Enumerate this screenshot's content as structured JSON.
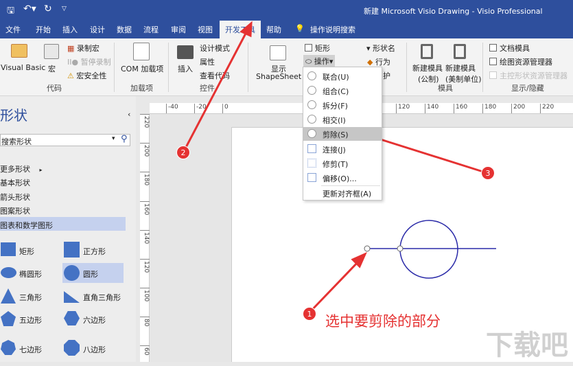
{
  "title": "新建 Microsoft Visio Drawing  -  Visio Professional",
  "tabs": [
    "文件",
    "开始",
    "插入",
    "设计",
    "数据",
    "流程",
    "审阅",
    "视图",
    "开发工具",
    "帮助",
    "操作说明搜索"
  ],
  "ribbon": {
    "code": {
      "vb": "Visual Basic",
      "macro": "宏",
      "record": "录制宏",
      "pause": "暂停录制",
      "security": "宏安全性",
      "group": "代码"
    },
    "addins": {
      "com": "COM 加载项",
      "group": "加载项"
    },
    "controls": {
      "insert": "插入",
      "design": "设计模式",
      "props": "属性",
      "viewcode": "查看代码",
      "group": "控件"
    },
    "shape": {
      "show": "显示",
      "shapesheet": "ShapeSheet",
      "rect": "矩形",
      "ops": "操作",
      "shapename": "形状名",
      "behavior": "行为",
      "protect": "护"
    },
    "stencil": {
      "new_metric": "新建模具",
      "metric": "(公制)",
      "new_us": "新建模具",
      "us": "(美制单位)",
      "group": "模具"
    },
    "showhide": {
      "doc": "文档模具",
      "explorer": "绘图资源管理器",
      "master": "主控形状资源管理器",
      "group": "显示/隐藏"
    }
  },
  "menu": [
    "联合(U)",
    "组合(C)",
    "拆分(F)",
    "相交(I)",
    "剪除(S)",
    "连接(J)",
    "修剪(T)",
    "偏移(O)...",
    "更新对齐框(A)"
  ],
  "sidebar": {
    "title": "形状",
    "search_placeholder": "搜索形状",
    "cats": [
      "更多形状",
      "基本形状",
      "箭头形状",
      "图案形状",
      "图表和数学图形"
    ],
    "shapes": [
      "矩形",
      "正方形",
      "椭圆形",
      "圆形",
      "三角形",
      "直角三角形",
      "五边形",
      "六边形",
      "七边形",
      "八边形"
    ]
  },
  "hruler": [
    "-40",
    "-20",
    "0",
    "120",
    "140",
    "160",
    "180",
    "200",
    "220"
  ],
  "vruler": [
    "220",
    "200",
    "180",
    "160",
    "140",
    "120",
    "100",
    "80",
    "60"
  ],
  "annotation": "选中要剪除的部分",
  "badges": [
    "1",
    "2",
    "3"
  ],
  "watermark": "下载吧"
}
